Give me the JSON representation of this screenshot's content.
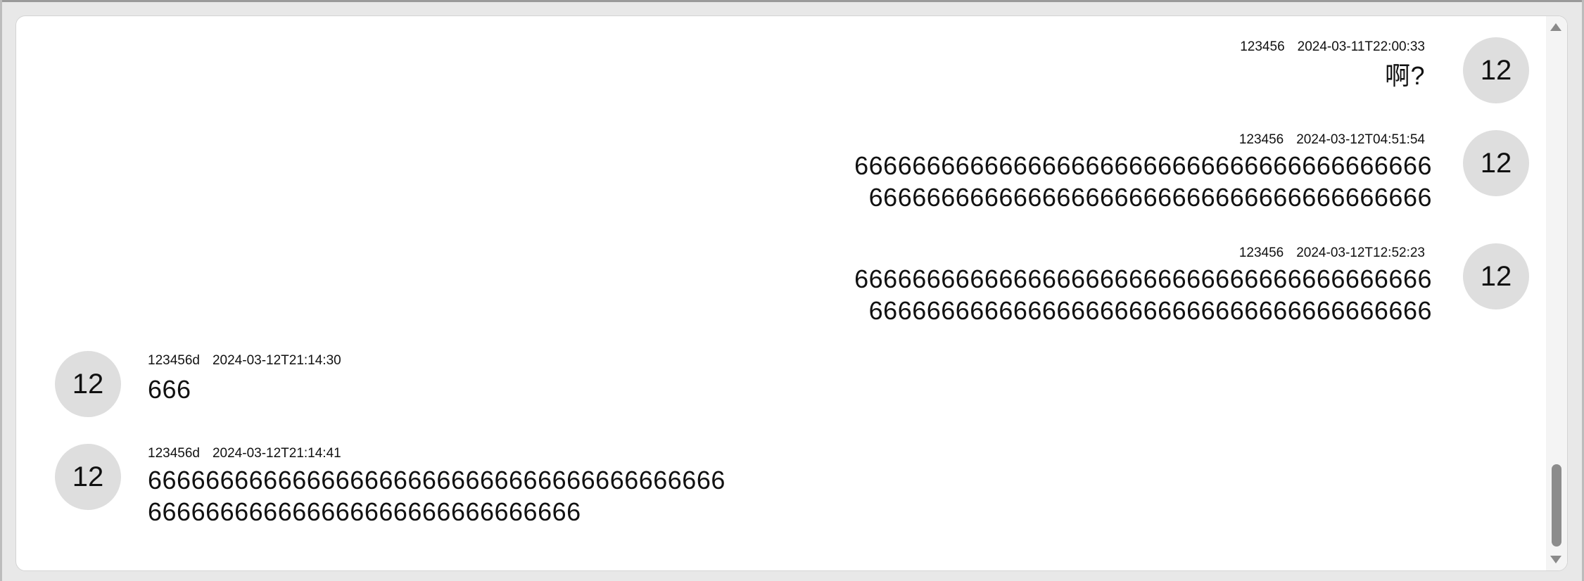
{
  "messages": [
    {
      "side": "right",
      "avatar": "12",
      "user": "123456",
      "time": "2024-03-11T22:00:33",
      "lines": [
        "啊?"
      ]
    },
    {
      "side": "right",
      "avatar": "12",
      "user": "123456",
      "time": "2024-03-12T04:51:54",
      "lines": [
        "6666666666666666666666666666666666666666",
        "666666666666666666666666666666666666666"
      ]
    },
    {
      "side": "right",
      "avatar": "12",
      "user": "123456",
      "time": "2024-03-12T12:52:23",
      "lines": [
        "6666666666666666666666666666666666666666",
        "666666666666666666666666666666666666666"
      ]
    },
    {
      "side": "left",
      "avatar": "12",
      "user": "123456d",
      "time": "2024-03-12T21:14:30",
      "lines": [
        "666"
      ]
    },
    {
      "side": "left",
      "avatar": "12",
      "user": "123456d",
      "time": "2024-03-12T21:14:41",
      "lines": [
        "6666666666666666666666666666666666666666",
        "666666666666666666666666666666"
      ]
    }
  ],
  "colors": {
    "avatar_bg": "#dedede",
    "panel_bg": "#ffffff",
    "page_bg": "#e8e8e8",
    "scroll_thumb": "#8c8c8c"
  }
}
